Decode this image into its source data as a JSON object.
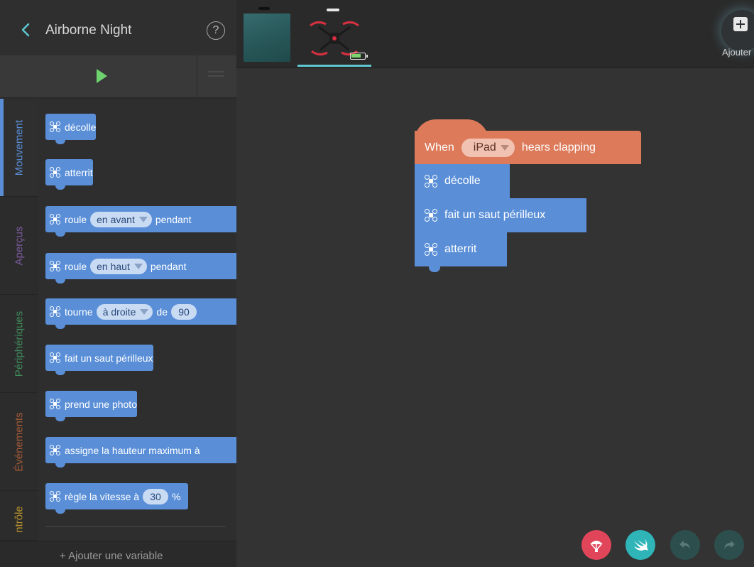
{
  "app": {
    "title": "Airborne Night",
    "help_glyph": "?",
    "add_variable_label": "+ Ajouter une variable"
  },
  "categories": [
    {
      "label": "Mouvement",
      "color": "#5a8fd8",
      "active": true
    },
    {
      "label": "Aperçus",
      "color": "#7a5a9c",
      "active": false
    },
    {
      "label": "Périphériques",
      "color": "#3f8a5a",
      "active": false
    },
    {
      "label": "Événements",
      "color": "#a35a36",
      "active": false
    },
    {
      "label": "ntrôle",
      "color": "#b5902a",
      "active": false
    }
  ],
  "palette": {
    "decolle": "décolle",
    "atterrit": "atterrit",
    "roule1": {
      "a": "roule",
      "opt": "en avant",
      "b": "pendant"
    },
    "roule2": {
      "a": "roule",
      "opt": "en haut",
      "b": "pendant"
    },
    "tourne": {
      "a": "tourne",
      "opt": "à droite",
      "b": "de",
      "num": "90"
    },
    "saut": "fait un saut périlleux",
    "photo": "prend une photo",
    "hauteur": "assigne la hauteur maximum à",
    "vitesse": {
      "a": "règle la vitesse à",
      "num": "30",
      "unit": "%"
    }
  },
  "device_strip": {
    "add_label": "Ajouter",
    "battery_level": 0.8
  },
  "workspace": {
    "hat": {
      "when": "When",
      "device": "iPad",
      "event": "hears clapping"
    },
    "blocks": [
      "décolle",
      "fait un saut périlleux",
      "atterrit"
    ]
  },
  "colors": {
    "motion_block": "#5a8fd8",
    "event_block": "#dd7a5a",
    "accent": "#5ec7d0"
  },
  "icons": {
    "back": "chevron-left-icon",
    "help": "help-circle-icon",
    "play": "play-icon",
    "menu": "menu-icon",
    "drone": "drone-icon",
    "add": "plus-square-icon",
    "parachute": "parachute-icon",
    "swift": "swift-icon",
    "undo": "undo-icon",
    "redo": "redo-icon"
  }
}
